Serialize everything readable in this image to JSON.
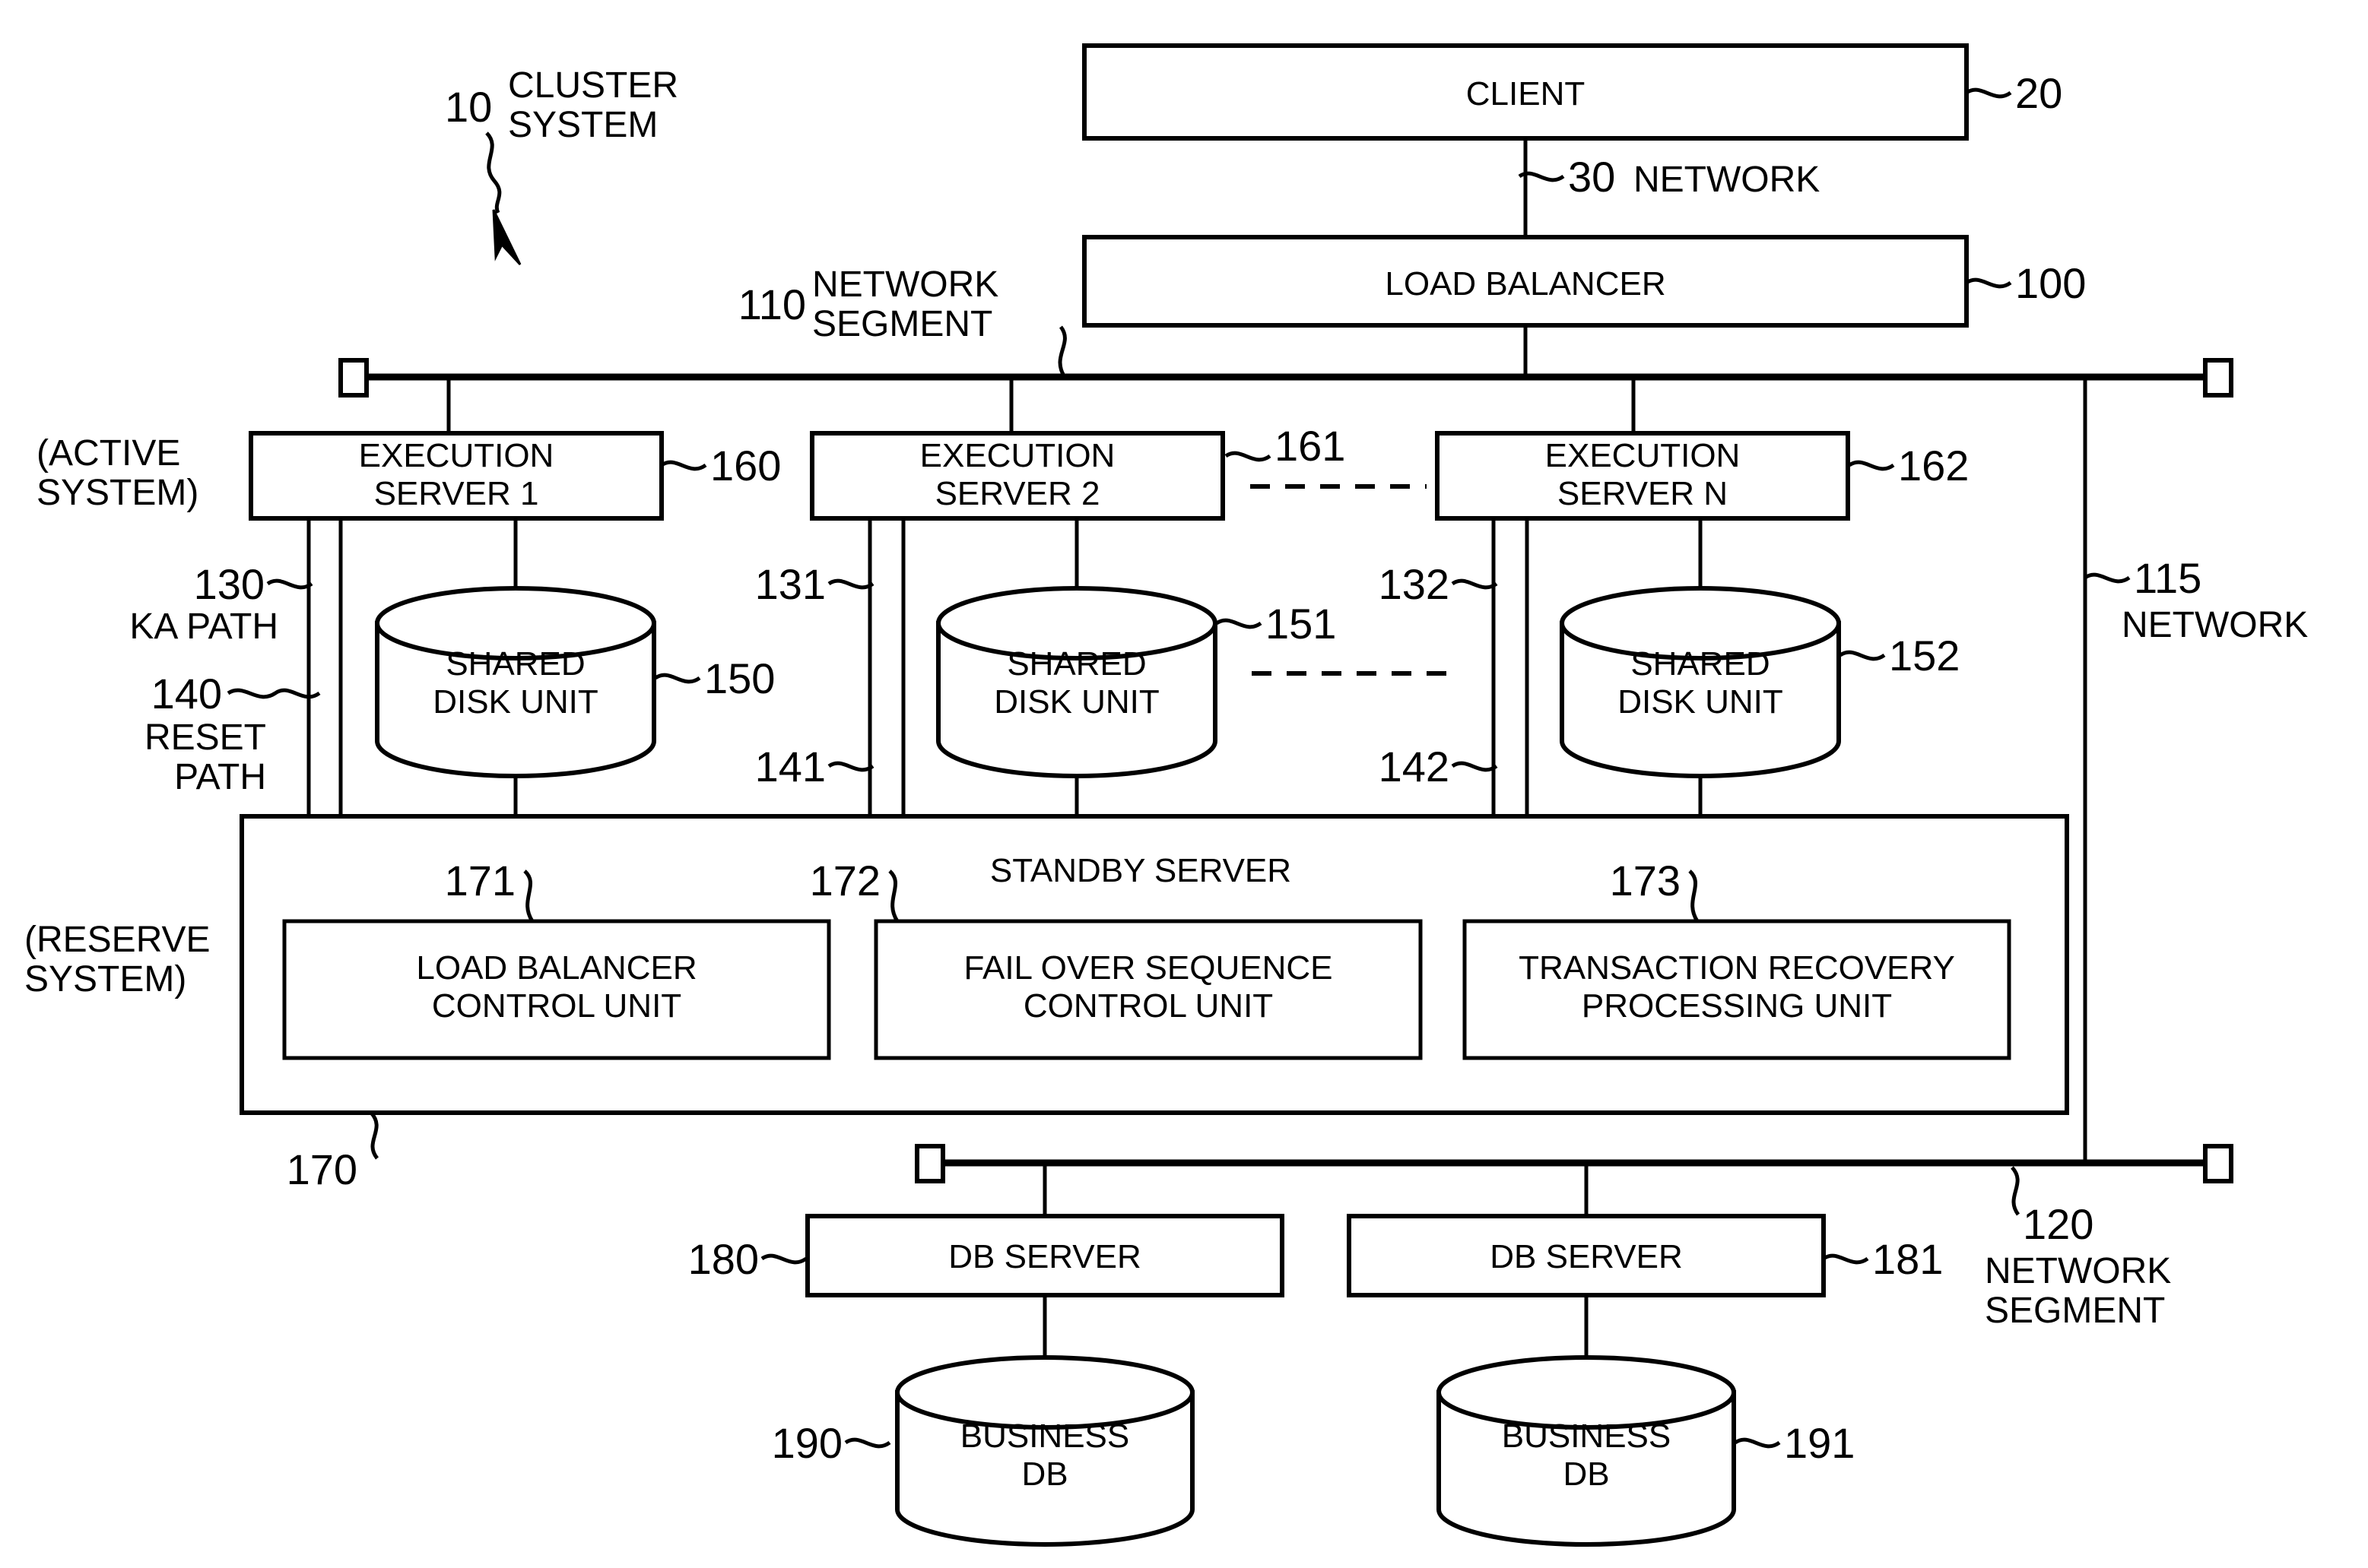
{
  "figure": {
    "title_ref": "10",
    "title_line1": "CLUSTER",
    "title_line2": "SYSTEM"
  },
  "labels": {
    "active_system_l1": "(ACTIVE",
    "active_system_l2": "SYSTEM)",
    "reserve_system_l1": "(RESERVE",
    "reserve_system_l2": "SYSTEM)",
    "ka_path_ref": "130",
    "ka_path_text": "KA PATH",
    "reset_path_ref": "140",
    "reset_path_l1": "RESET",
    "reset_path_l2": "PATH",
    "ka_path_ref_2": "131",
    "reset_path_ref_2": "141",
    "ka_path_ref_3": "132",
    "reset_path_ref_3": "142",
    "network_30_ref": "30",
    "network_30_text": "NETWORK",
    "network_segment_110_ref": "110",
    "network_segment_110_l1": "NETWORK",
    "network_segment_110_l2": "SEGMENT",
    "network_115_ref": "115",
    "network_115_text": "NETWORK",
    "network_segment_120_ref": "120",
    "network_segment_120_l1": "NETWORK",
    "network_segment_120_l2": "SEGMENT",
    "standby_server_ref": "170",
    "standby_server_title": "STANDBY SERVER"
  },
  "nodes": {
    "client": {
      "label": "CLIENT",
      "ref": "20"
    },
    "load_balancer": {
      "label": "LOAD BALANCER",
      "ref": "100"
    },
    "exec_server_1": {
      "line1": "EXECUTION",
      "line2": "SERVER 1",
      "ref": "160"
    },
    "exec_server_2": {
      "line1": "EXECUTION",
      "line2": "SERVER 2",
      "ref": "161"
    },
    "exec_server_n": {
      "line1": "EXECUTION",
      "line2": "SERVER N",
      "ref": "162"
    },
    "shared_disk_1": {
      "line1": "SHARED",
      "line2": "DISK UNIT",
      "ref": "150"
    },
    "shared_disk_2": {
      "line1": "SHARED",
      "line2": "DISK UNIT",
      "ref": "151"
    },
    "shared_disk_n": {
      "line1": "SHARED",
      "line2": "DISK UNIT",
      "ref": "152"
    },
    "load_balancer_control_unit": {
      "line1": "LOAD BALANCER",
      "line2": "CONTROL UNIT",
      "ref": "171"
    },
    "fail_over_sequence_control_unit": {
      "line1": "FAIL OVER SEQUENCE",
      "line2": "CONTROL UNIT",
      "ref": "172"
    },
    "transaction_recovery_processing_unit": {
      "line1": "TRANSACTION RECOVERY",
      "line2": "PROCESSING UNIT",
      "ref": "173"
    },
    "db_server_left": {
      "label": "DB SERVER",
      "ref": "180"
    },
    "db_server_right": {
      "label": "DB SERVER",
      "ref": "181"
    },
    "business_db_left": {
      "line1": "BUSINESS",
      "line2": "DB",
      "ref": "190"
    },
    "business_db_right": {
      "line1": "BUSINESS",
      "line2": "DB",
      "ref": "191"
    }
  },
  "colors": {
    "ink": "#000000",
    "paper": "#ffffff"
  }
}
